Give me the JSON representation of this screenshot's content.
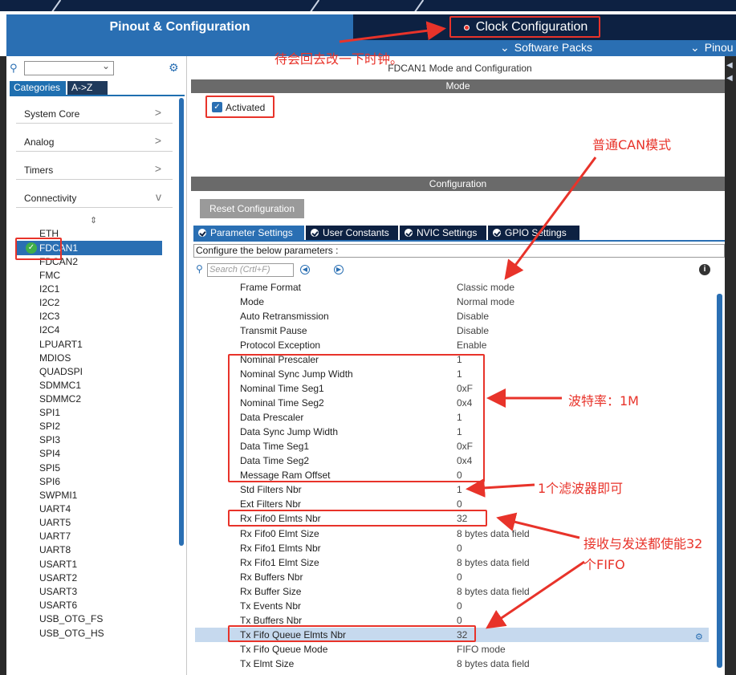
{
  "top_tabs": {
    "pinout": "Pinout & Configuration",
    "clock": "Clock Configuration",
    "clock_dot_color": "#e8332a"
  },
  "subbar": {
    "software_packs": "Software Packs",
    "pinout": "Pinou"
  },
  "left": {
    "tabs": {
      "categories": "Categories",
      "az": "A->Z"
    },
    "categories": [
      {
        "label": "System Core",
        "chevron": ">"
      },
      {
        "label": "Analog",
        "chevron": ">"
      },
      {
        "label": "Timers",
        "chevron": ">"
      },
      {
        "label": "Connectivity",
        "chevron": "v"
      }
    ],
    "peripherals": [
      "ETH",
      "FDCAN1",
      "FDCAN2",
      "FMC",
      "I2C1",
      "I2C2",
      "I2C3",
      "I2C4",
      "LPUART1",
      "MDIOS",
      "QUADSPI",
      "SDMMC1",
      "SDMMC2",
      "SPI1",
      "SPI2",
      "SPI3",
      "SPI4",
      "SPI5",
      "SPI6",
      "SWPMI1",
      "UART4",
      "UART5",
      "UART7",
      "UART8",
      "USART1",
      "USART2",
      "USART3",
      "USART6",
      "USB_OTG_FS",
      "USB_OTG_HS"
    ],
    "selected": "FDCAN1"
  },
  "right": {
    "title": "FDCAN1 Mode and Configuration",
    "mode_header": "Mode",
    "activated_label": "Activated",
    "config_header": "Configuration",
    "reset_button": "Reset Configuration",
    "tabs": [
      "Parameter Settings",
      "User Constants",
      "NVIC Settings",
      "GPIO Settings"
    ],
    "configure_label": "Configure the below parameters :",
    "search_placeholder": "Search (Crtl+F)",
    "params": [
      {
        "name": "Frame Format",
        "value": "Classic mode"
      },
      {
        "name": "Mode",
        "value": "Normal mode"
      },
      {
        "name": "Auto Retransmission",
        "value": "Disable"
      },
      {
        "name": "Transmit Pause",
        "value": "Disable"
      },
      {
        "name": "Protocol Exception",
        "value": "Enable"
      },
      {
        "name": "Nominal Prescaler",
        "value": "1"
      },
      {
        "name": "Nominal Sync Jump Width",
        "value": "1"
      },
      {
        "name": "Nominal Time Seg1",
        "value": "0xF"
      },
      {
        "name": "Nominal Time Seg2",
        "value": "0x4"
      },
      {
        "name": "Data Prescaler",
        "value": "1"
      },
      {
        "name": "Data Sync Jump Width",
        "value": "1"
      },
      {
        "name": "Data Time Seg1",
        "value": "0xF"
      },
      {
        "name": "Data Time Seg2",
        "value": "0x4"
      },
      {
        "name": "Message Ram Offset",
        "value": "0"
      },
      {
        "name": "Std Filters Nbr",
        "value": "1"
      },
      {
        "name": "Ext Filters Nbr",
        "value": "0"
      },
      {
        "name": "Rx Fifo0 Elmts Nbr",
        "value": "32"
      },
      {
        "name": "Rx Fifo0 Elmt Size",
        "value": "8 bytes data field"
      },
      {
        "name": "Rx Fifo1 Elmts Nbr",
        "value": "0"
      },
      {
        "name": "Rx Fifo1 Elmt Size",
        "value": "8 bytes data field"
      },
      {
        "name": "Rx Buffers Nbr",
        "value": "0"
      },
      {
        "name": "Rx Buffer Size",
        "value": "8 bytes data field"
      },
      {
        "name": "Tx Events Nbr",
        "value": "0"
      },
      {
        "name": "Tx Buffers Nbr",
        "value": "0"
      },
      {
        "name": "Tx Fifo Queue Elmts Nbr",
        "value": "32"
      },
      {
        "name": "Tx Fifo Queue Mode",
        "value": "FIFO mode"
      },
      {
        "name": "Tx Elmt Size",
        "value": "8 bytes data field"
      }
    ],
    "selected_param": "Tx Fifo Queue Elmts Nbr"
  },
  "annotations": {
    "clock_note": "待会回去改一下时钟。",
    "can_mode": "普通CAN模式",
    "baud": "波特率：1M",
    "filter": "1个滤波器即可",
    "fifo_line1": "接收与发送都使能32",
    "fifo_line2": "个FIFO",
    "color": "#e8332a"
  }
}
